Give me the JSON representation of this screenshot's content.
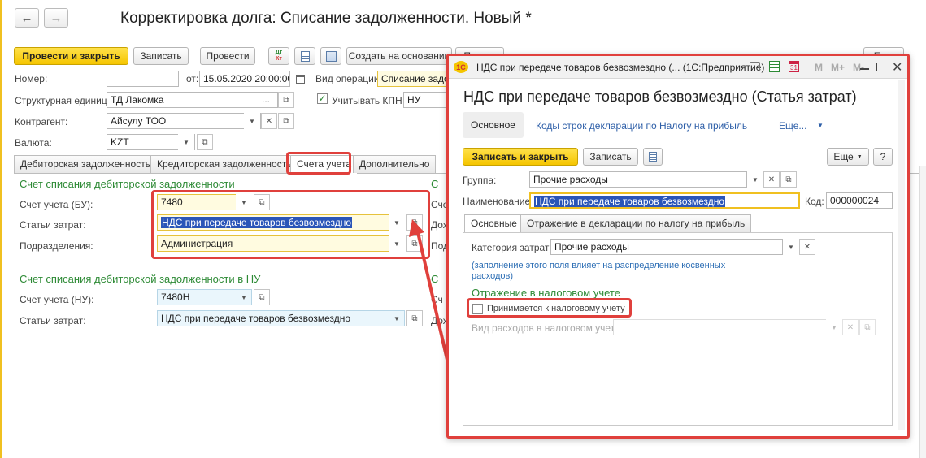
{
  "main": {
    "title": "Корректировка долга: Списание задолженности. Новый *",
    "toolbar": {
      "post_close": "Провести и закрыть",
      "save": "Записать",
      "post": "Провести",
      "dtkt": "Дт Кт",
      "create_based": "Создать на основании",
      "print": "Печать",
      "more": "Еще"
    },
    "number_label": "Номер:",
    "number_value": "",
    "date_from_label": "от:",
    "date_value": "15.05.2020 20:00:00",
    "operation_label": "Вид операции:",
    "operation_value": "Списание задолж",
    "struct_unit_label": "Структурная единица:",
    "struct_unit_value": "ТД Лакомка",
    "kpn_label": "Учитывать КПН",
    "kpn_value": "НУ",
    "kpn_checked": true,
    "counterparty_label": "Контрагент:",
    "counterparty_value": "Айсулу ТОО",
    "currency_label": "Валюта:",
    "currency_value": "KZT",
    "tabs": [
      "Дебиторская задолженность",
      "Кредиторская задолженность",
      "Счета учета",
      "Дополнительно"
    ],
    "section1_title": "Счет списания дебиторской задолженности",
    "section1_right_title": "С",
    "acct_bu_label": "Счет учета (БУ):",
    "acct_bu_value": "7480",
    "cost_items_label": "Статьи затрат:",
    "cost_items_value": "НДС при передаче товаров безвозмездно",
    "divisions_label": "Подразделения:",
    "divisions_value": "Администрация",
    "right_col_labels": [
      "Счет",
      "Дох",
      "Под"
    ],
    "section2_title": "Счет списания дебиторской задолженности в НУ",
    "section2_right_title": "С",
    "acct_nu_label": "Счет учета (НУ):",
    "acct_nu_value": "7480Н",
    "cost_items2_label": "Статьи затрат:",
    "cost_items2_value": "НДС при передаче товаров безвозмездно",
    "right_col2_labels": [
      "Сч",
      "Дох"
    ]
  },
  "popup": {
    "window_title": "НДС при передаче товаров безвозмездно (... (1С:Предприятие)",
    "heading": "НДС при передаче товаров безвозмездно (Статья затрат)",
    "nav": {
      "main": "Основное",
      "codes": "Коды строк декларации по Налогу на прибыль",
      "more": "Еще..."
    },
    "save_close": "Записать и закрыть",
    "save": "Записать",
    "more": "Еще",
    "help": "?",
    "group_label": "Группа:",
    "group_value": "Прочие расходы",
    "name_label": "Наименование:",
    "name_value": "НДС при передаче товаров безвозмездно",
    "code_label": "Код:",
    "code_value": "000000024",
    "tabs": [
      "Основные",
      "Отражение в декларации по налогу на прибыль"
    ],
    "category_label": "Категория затрат:",
    "category_value": "Прочие расходы",
    "hint": "(заполнение этого поля влияет на распределение косвенных расходов)",
    "tax_section": "Отражение в налоговом учете",
    "tax_accepted_label": "Принимается к налоговому учету",
    "tax_accepted_checked": false,
    "expense_type_label": "Вид расходов в налоговом учете:",
    "expense_type_value": "",
    "title_icons": [
      "М",
      "М+",
      "М-"
    ]
  }
}
